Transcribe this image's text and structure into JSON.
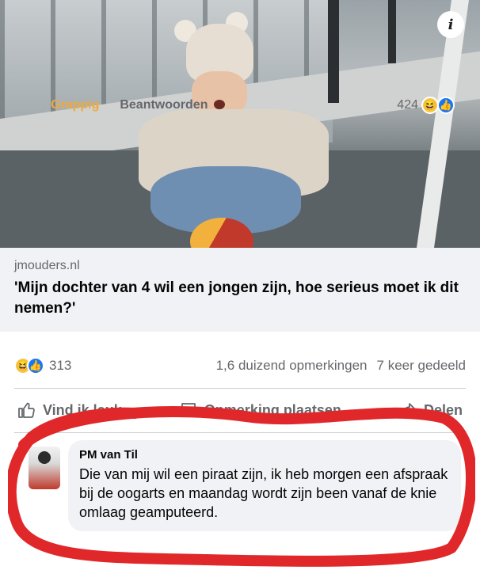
{
  "post": {
    "info_icon": "info-icon",
    "link": {
      "domain": "jmouders.nl",
      "title": "'Mijn dochter van 4 wil een jongen zijn, hoe serieus moet ik dit nemen?'"
    },
    "stats": {
      "reaction_icons": [
        "haha-icon",
        "like-icon"
      ],
      "reaction_count": "313",
      "comments": "1,6 duizend opmerkingen",
      "shares": "7 keer gedeeld"
    },
    "actions": {
      "like": "Vind ik leuk",
      "comment": "Opmerking plaatsen",
      "share": "Delen"
    }
  },
  "comment": {
    "author": "PM van Til",
    "text": "Die van mij wil een piraat zijn, ik heb morgen een afspraak bij de oogarts en maandag wordt zijn been vanaf de knie omlaag geamputeerd.",
    "reaction_label": "Grappig",
    "reply_label": "Beantwoorden",
    "reaction_count": "424"
  },
  "colors": {
    "highlight": "#e0282a",
    "like_blue": "#1877f2",
    "haha_yellow": "#f7c84a"
  }
}
